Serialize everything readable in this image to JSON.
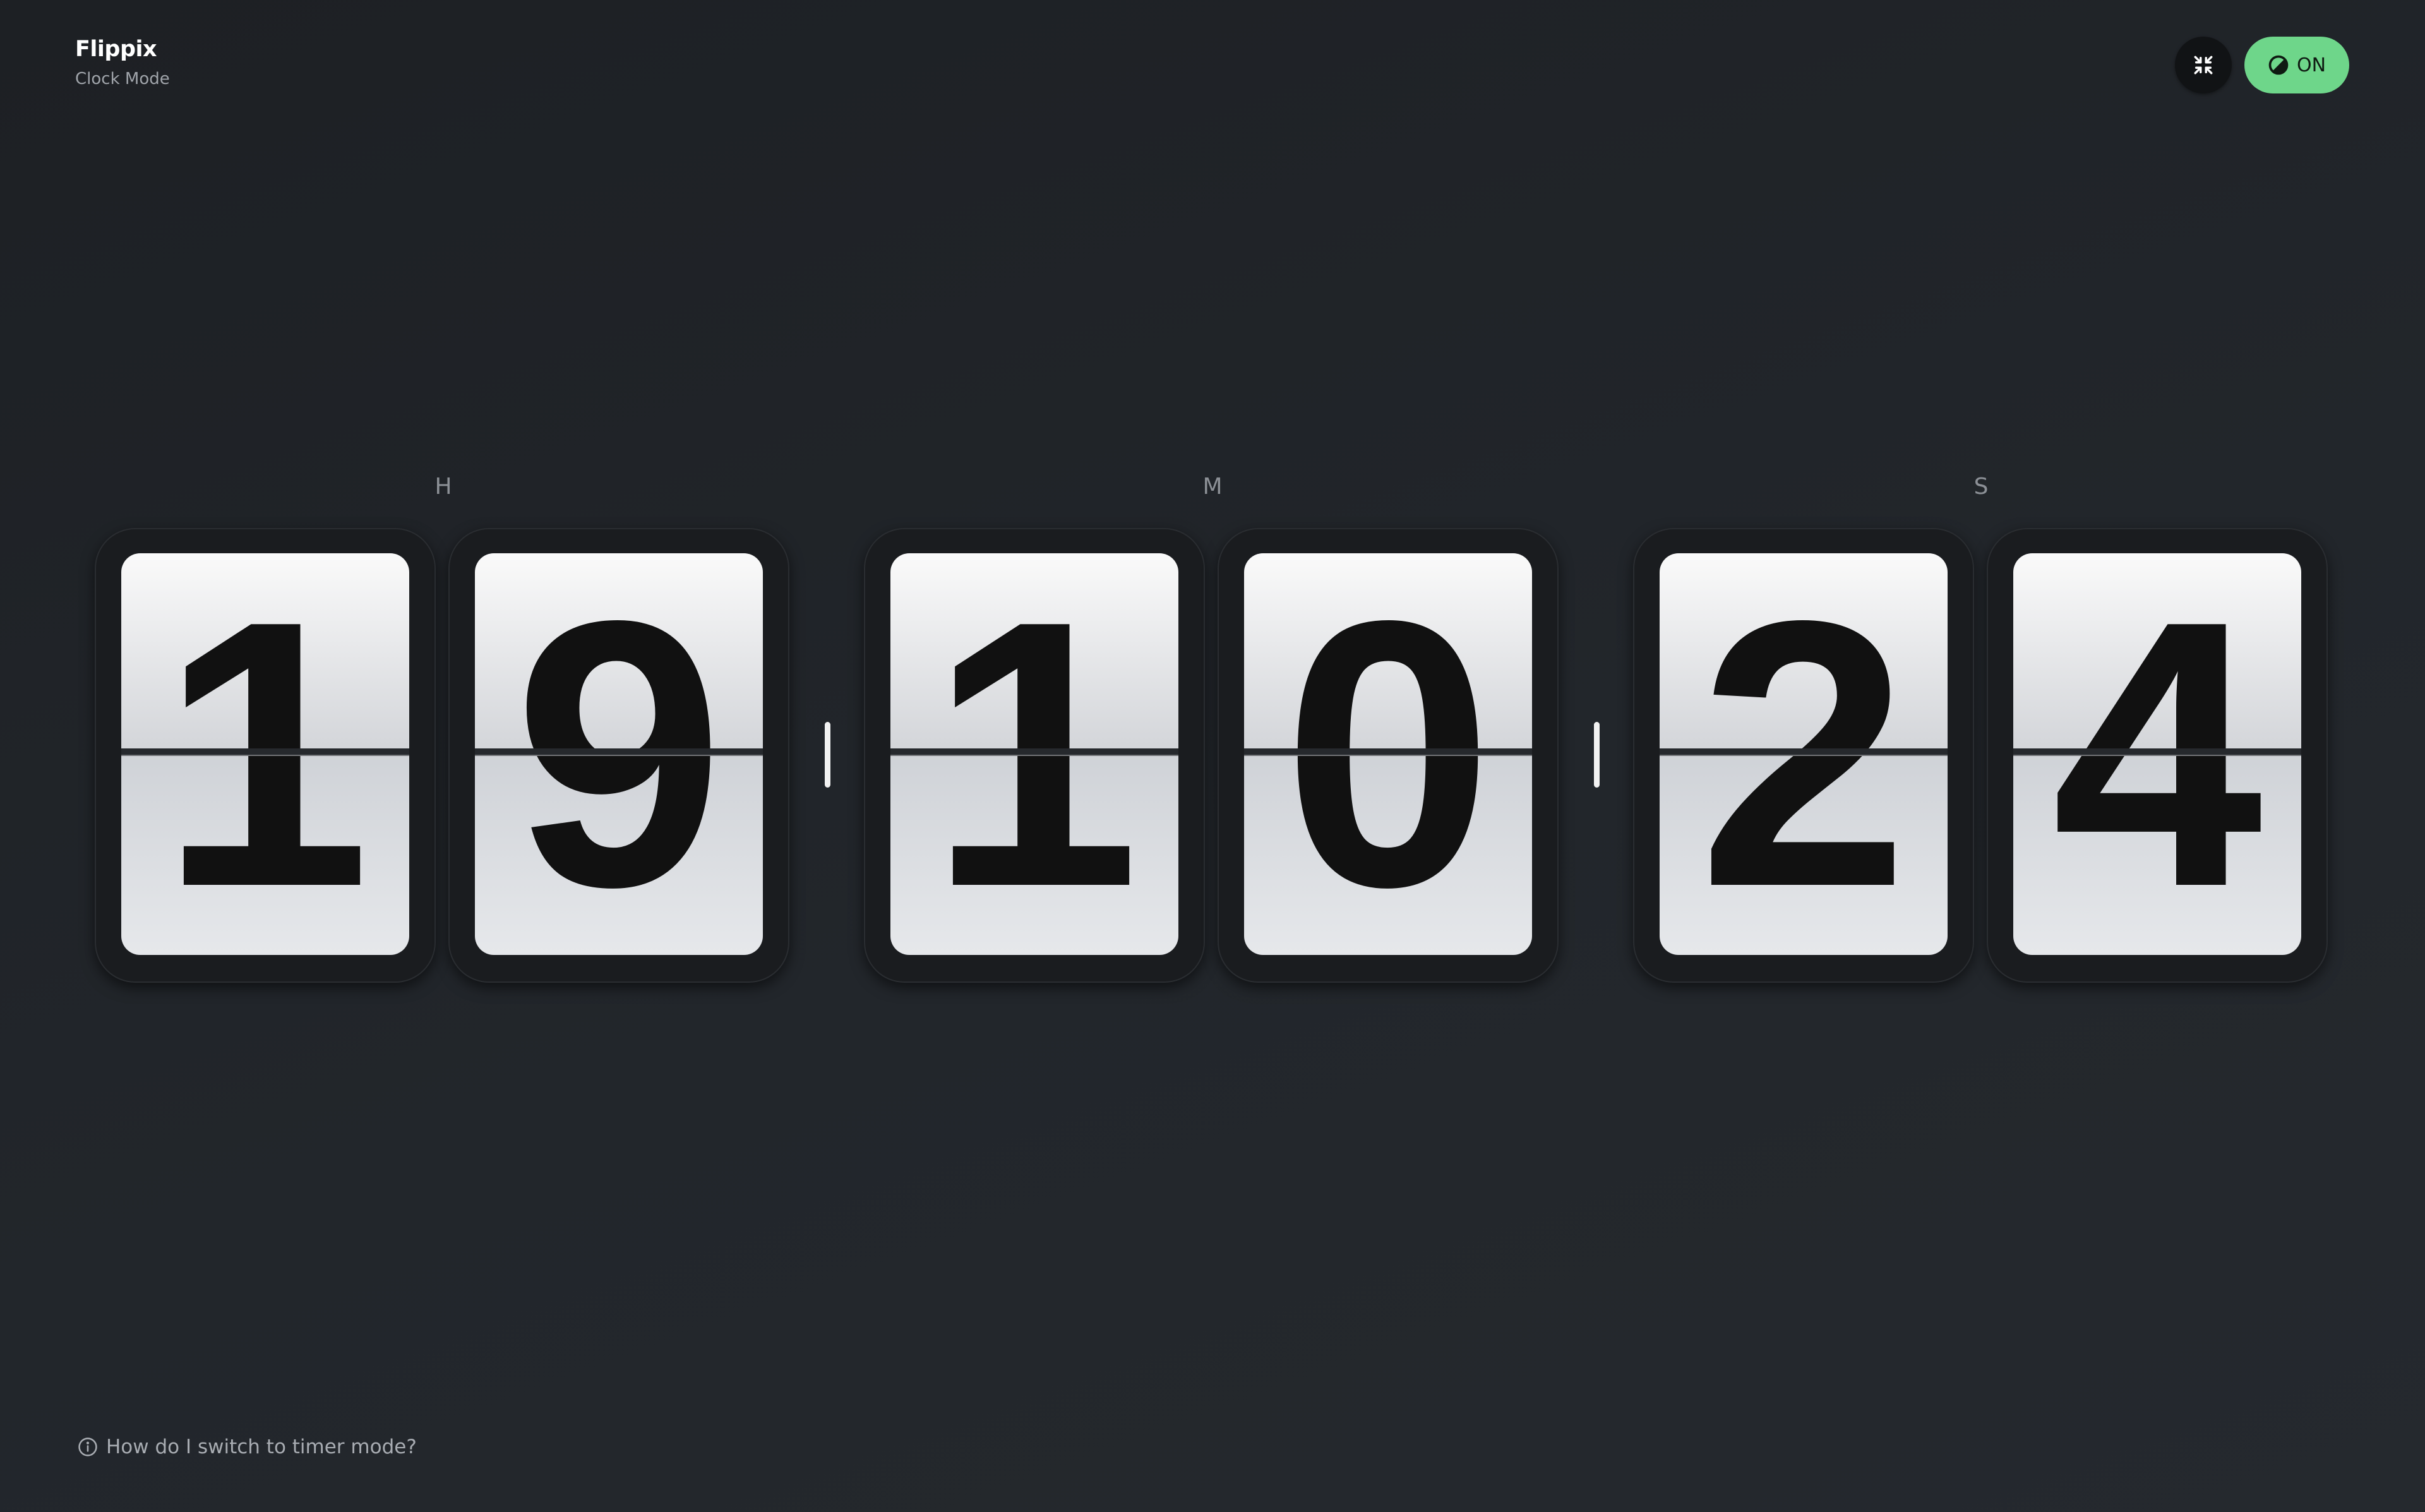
{
  "app": {
    "title": "Flippix",
    "subtitle": "Clock Mode"
  },
  "controls": {
    "exit_fullscreen_icon": "exit-fullscreen-icon",
    "theme_icon": "contrast-icon",
    "theme_label": "ON",
    "theme_color": "#6ed68a"
  },
  "clock": {
    "hours_label": "H",
    "minutes_label": "M",
    "seconds_label": "S",
    "digits": [
      "1",
      "9",
      "1",
      "0",
      "2",
      "4"
    ]
  },
  "footer": {
    "help_icon": "info-icon",
    "help_text": "How do I switch to timer mode?"
  }
}
